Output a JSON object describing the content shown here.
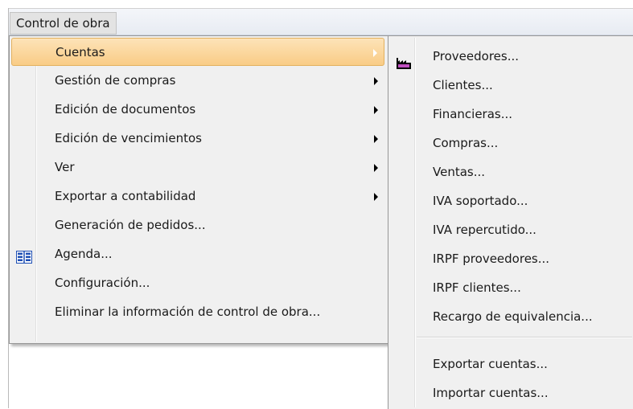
{
  "menubar": {
    "title": "Control de obra"
  },
  "main_menu": {
    "items": [
      {
        "label": "Cuentas",
        "submenu": true
      },
      {
        "label": "Gestión de compras",
        "submenu": true
      },
      {
        "label": "Edición de documentos",
        "submenu": true
      },
      {
        "label": "Edición de vencimientos",
        "submenu": true
      },
      {
        "label": "Ver",
        "submenu": true
      },
      {
        "label": "Exportar a contabilidad",
        "submenu": true
      },
      {
        "label": "Generación de pedidos...",
        "submenu": false
      },
      {
        "label": "Agenda...",
        "submenu": false,
        "icon": "book-icon"
      },
      {
        "label": "Configuración...",
        "submenu": false
      },
      {
        "label": "Eliminar la información de control de obra...",
        "submenu": false
      }
    ]
  },
  "sub_menu": {
    "items": [
      {
        "label": "Proveedores...",
        "icon": "factory-icon"
      },
      {
        "label": "Clientes..."
      },
      {
        "label": "Financieras..."
      },
      {
        "label": "Compras..."
      },
      {
        "label": "Ventas..."
      },
      {
        "label": "IVA soportado..."
      },
      {
        "label": "IVA repercutido..."
      },
      {
        "label": "IRPF proveedores..."
      },
      {
        "label": "IRPF clientes..."
      },
      {
        "label": "Recargo de equivalencia..."
      },
      {
        "label": "Exportar cuentas..."
      },
      {
        "label": "Importar cuentas..."
      }
    ]
  },
  "colors": {
    "highlight": "#f9cc86",
    "menu_background": "#f0f0f0",
    "border": "#979797"
  }
}
